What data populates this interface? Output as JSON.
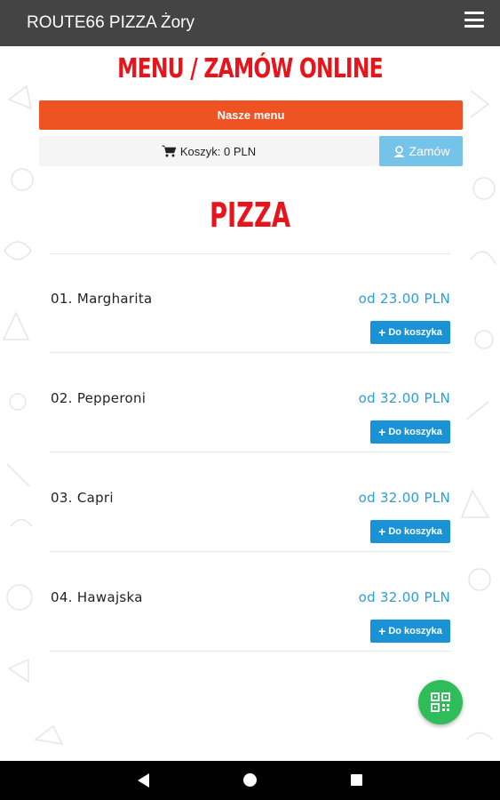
{
  "app": {
    "title": "ROUTE66 PIZZA Żory",
    "menu_icon": "hamburger-menu-icon"
  },
  "header": {
    "heading": "MENU / ZAMÓW ONLINE"
  },
  "actions": {
    "menu_button": "Nasze menu",
    "cart_label": "Koszyk: 0 PLN",
    "order_button": "Zamów"
  },
  "category": {
    "title": "PIZZA"
  },
  "items": [
    {
      "name": "01. Margharita",
      "price": "od 23.00 PLN",
      "add_label": "Do koszyka"
    },
    {
      "name": "02. Pepperoni",
      "price": "od 32.00 PLN",
      "add_label": "Do koszyka"
    },
    {
      "name": "03. Capri",
      "price": "od 32.00 PLN",
      "add_label": "Do koszyka"
    },
    {
      "name": "04. Hawajska",
      "price": "od 32.00 PLN",
      "add_label": "Do koszyka"
    }
  ],
  "colors": {
    "appbar": "#444444",
    "heading_red": "#e8141b",
    "menu_button": "#f05323",
    "order_button": "#76c3ea",
    "price_blue": "#2b9ed9",
    "add_button": "#1a93d6",
    "fab_green": "#2ebd59"
  },
  "icons": {
    "cart": "shopping-cart-icon",
    "order": "order-icon",
    "add": "plus-icon",
    "fab": "qr-code-icon",
    "nav_back": "back-icon",
    "nav_home": "home-icon",
    "nav_recent": "recent-apps-icon"
  }
}
